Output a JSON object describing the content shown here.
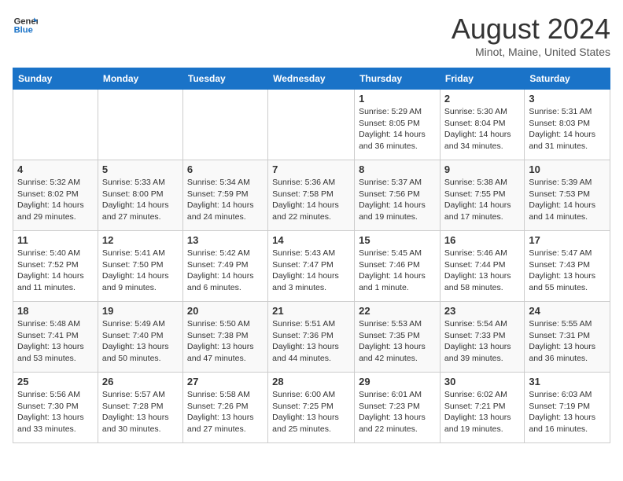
{
  "header": {
    "logo_line1": "General",
    "logo_line2": "Blue",
    "month": "August 2024",
    "location": "Minot, Maine, United States"
  },
  "weekdays": [
    "Sunday",
    "Monday",
    "Tuesday",
    "Wednesday",
    "Thursday",
    "Friday",
    "Saturday"
  ],
  "weeks": [
    [
      {
        "day": "",
        "info": ""
      },
      {
        "day": "",
        "info": ""
      },
      {
        "day": "",
        "info": ""
      },
      {
        "day": "",
        "info": ""
      },
      {
        "day": "1",
        "info": "Sunrise: 5:29 AM\nSunset: 8:05 PM\nDaylight: 14 hours\nand 36 minutes."
      },
      {
        "day": "2",
        "info": "Sunrise: 5:30 AM\nSunset: 8:04 PM\nDaylight: 14 hours\nand 34 minutes."
      },
      {
        "day": "3",
        "info": "Sunrise: 5:31 AM\nSunset: 8:03 PM\nDaylight: 14 hours\nand 31 minutes."
      }
    ],
    [
      {
        "day": "4",
        "info": "Sunrise: 5:32 AM\nSunset: 8:02 PM\nDaylight: 14 hours\nand 29 minutes."
      },
      {
        "day": "5",
        "info": "Sunrise: 5:33 AM\nSunset: 8:00 PM\nDaylight: 14 hours\nand 27 minutes."
      },
      {
        "day": "6",
        "info": "Sunrise: 5:34 AM\nSunset: 7:59 PM\nDaylight: 14 hours\nand 24 minutes."
      },
      {
        "day": "7",
        "info": "Sunrise: 5:36 AM\nSunset: 7:58 PM\nDaylight: 14 hours\nand 22 minutes."
      },
      {
        "day": "8",
        "info": "Sunrise: 5:37 AM\nSunset: 7:56 PM\nDaylight: 14 hours\nand 19 minutes."
      },
      {
        "day": "9",
        "info": "Sunrise: 5:38 AM\nSunset: 7:55 PM\nDaylight: 14 hours\nand 17 minutes."
      },
      {
        "day": "10",
        "info": "Sunrise: 5:39 AM\nSunset: 7:53 PM\nDaylight: 14 hours\nand 14 minutes."
      }
    ],
    [
      {
        "day": "11",
        "info": "Sunrise: 5:40 AM\nSunset: 7:52 PM\nDaylight: 14 hours\nand 11 minutes."
      },
      {
        "day": "12",
        "info": "Sunrise: 5:41 AM\nSunset: 7:50 PM\nDaylight: 14 hours\nand 9 minutes."
      },
      {
        "day": "13",
        "info": "Sunrise: 5:42 AM\nSunset: 7:49 PM\nDaylight: 14 hours\nand 6 minutes."
      },
      {
        "day": "14",
        "info": "Sunrise: 5:43 AM\nSunset: 7:47 PM\nDaylight: 14 hours\nand 3 minutes."
      },
      {
        "day": "15",
        "info": "Sunrise: 5:45 AM\nSunset: 7:46 PM\nDaylight: 14 hours\nand 1 minute."
      },
      {
        "day": "16",
        "info": "Sunrise: 5:46 AM\nSunset: 7:44 PM\nDaylight: 13 hours\nand 58 minutes."
      },
      {
        "day": "17",
        "info": "Sunrise: 5:47 AM\nSunset: 7:43 PM\nDaylight: 13 hours\nand 55 minutes."
      }
    ],
    [
      {
        "day": "18",
        "info": "Sunrise: 5:48 AM\nSunset: 7:41 PM\nDaylight: 13 hours\nand 53 minutes."
      },
      {
        "day": "19",
        "info": "Sunrise: 5:49 AM\nSunset: 7:40 PM\nDaylight: 13 hours\nand 50 minutes."
      },
      {
        "day": "20",
        "info": "Sunrise: 5:50 AM\nSunset: 7:38 PM\nDaylight: 13 hours\nand 47 minutes."
      },
      {
        "day": "21",
        "info": "Sunrise: 5:51 AM\nSunset: 7:36 PM\nDaylight: 13 hours\nand 44 minutes."
      },
      {
        "day": "22",
        "info": "Sunrise: 5:53 AM\nSunset: 7:35 PM\nDaylight: 13 hours\nand 42 minutes."
      },
      {
        "day": "23",
        "info": "Sunrise: 5:54 AM\nSunset: 7:33 PM\nDaylight: 13 hours\nand 39 minutes."
      },
      {
        "day": "24",
        "info": "Sunrise: 5:55 AM\nSunset: 7:31 PM\nDaylight: 13 hours\nand 36 minutes."
      }
    ],
    [
      {
        "day": "25",
        "info": "Sunrise: 5:56 AM\nSunset: 7:30 PM\nDaylight: 13 hours\nand 33 minutes."
      },
      {
        "day": "26",
        "info": "Sunrise: 5:57 AM\nSunset: 7:28 PM\nDaylight: 13 hours\nand 30 minutes."
      },
      {
        "day": "27",
        "info": "Sunrise: 5:58 AM\nSunset: 7:26 PM\nDaylight: 13 hours\nand 27 minutes."
      },
      {
        "day": "28",
        "info": "Sunrise: 6:00 AM\nSunset: 7:25 PM\nDaylight: 13 hours\nand 25 minutes."
      },
      {
        "day": "29",
        "info": "Sunrise: 6:01 AM\nSunset: 7:23 PM\nDaylight: 13 hours\nand 22 minutes."
      },
      {
        "day": "30",
        "info": "Sunrise: 6:02 AM\nSunset: 7:21 PM\nDaylight: 13 hours\nand 19 minutes."
      },
      {
        "day": "31",
        "info": "Sunrise: 6:03 AM\nSunset: 7:19 PM\nDaylight: 13 hours\nand 16 minutes."
      }
    ]
  ]
}
